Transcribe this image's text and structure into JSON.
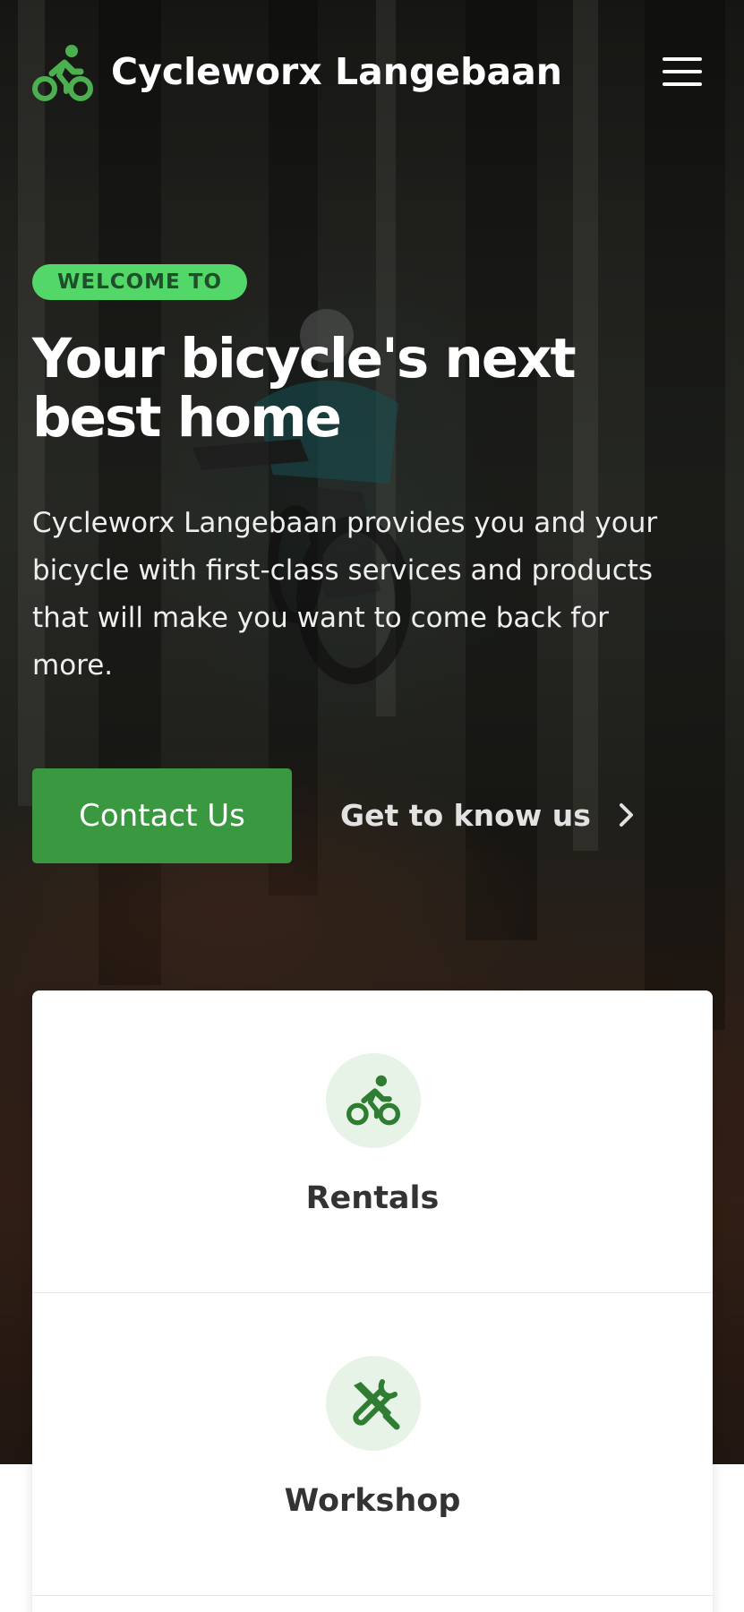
{
  "header": {
    "brand": "Cycleworx Langebaan",
    "logo_icon": "cyclist-icon",
    "menu_icon": "hamburger-menu-icon"
  },
  "hero": {
    "badge": "WELCOME TO",
    "headline": "Your bicycle's next best home",
    "lead": "Cycleworx Langebaan provides you and your bicycle with first-class services and products that will make you want to come back for more.",
    "primary_button": "Contact Us",
    "secondary_link": "Get to know us",
    "secondary_icon": "chevron-right-icon"
  },
  "services": [
    {
      "title": "Rentals",
      "icon": "cyclist-icon"
    },
    {
      "title": "Workshop",
      "icon": "tools-icon"
    }
  ],
  "colors": {
    "accent": "#3a9840",
    "badge_bg": "#52d768",
    "icon_green": "#2e7d32",
    "icon_bg": "#e7f3e7"
  }
}
